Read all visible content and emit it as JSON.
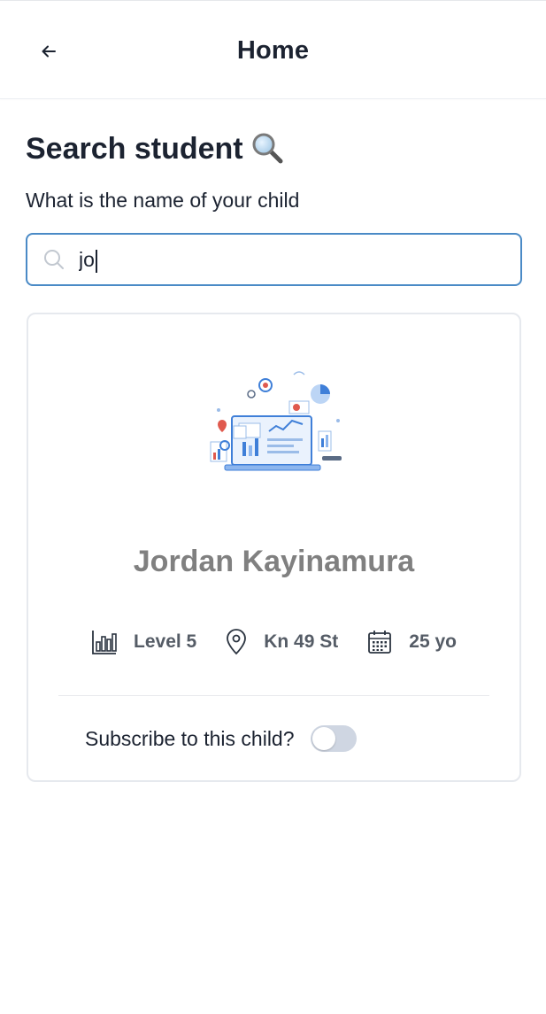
{
  "header": {
    "title": "Home",
    "back_icon": "arrow-left-icon"
  },
  "main": {
    "page_title": "Search student",
    "page_title_icon": "magnifying-glass-emoji",
    "prompt": "What is the name of your child",
    "search": {
      "value": "jo",
      "placeholder": "",
      "icon": "search-icon"
    }
  },
  "result_card": {
    "illustration": "analytics-dashboard-illustration",
    "name": "Jordan Kayinamura",
    "level": {
      "icon": "bar-chart-icon",
      "label": "Level 5"
    },
    "location": {
      "icon": "map-pin-icon",
      "label": "Kn 49 St"
    },
    "age": {
      "icon": "calendar-icon",
      "label": "25 yo"
    },
    "subscribe_label": "Subscribe to this child?",
    "subscribed": false
  },
  "colors": {
    "accent_border": "#4a8ac6",
    "name_gray": "#808080",
    "toggle_off": "#cfd6e2"
  }
}
